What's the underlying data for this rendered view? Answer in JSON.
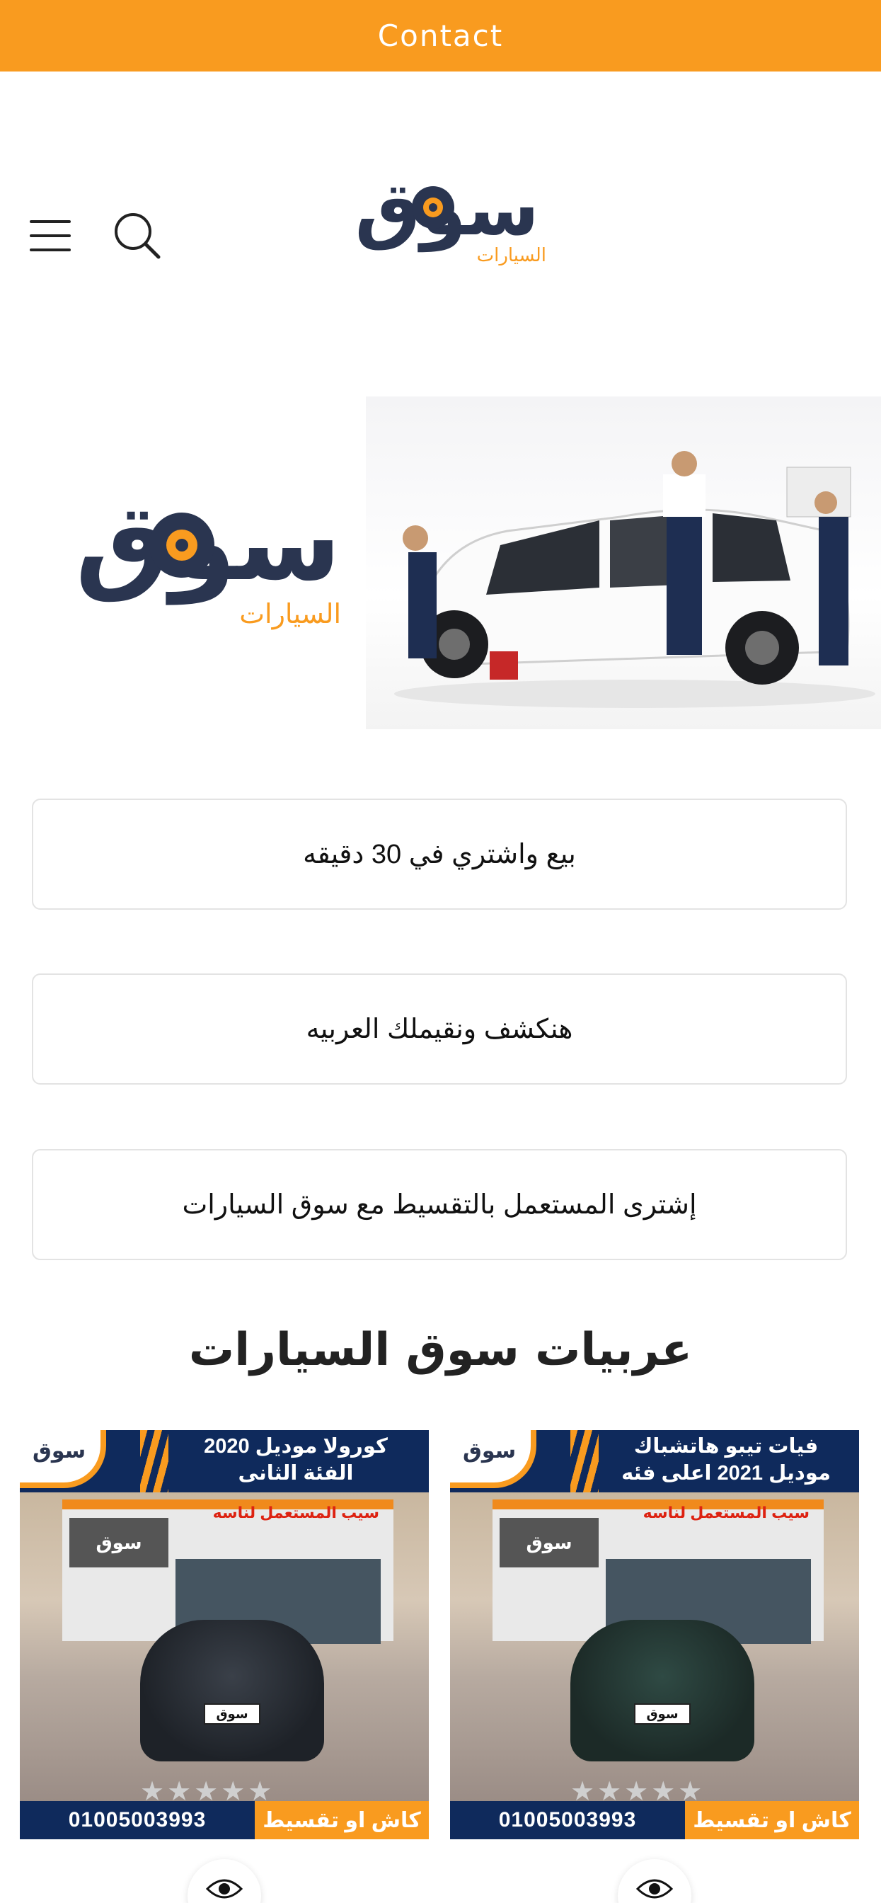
{
  "topbar": {
    "contact_label": "Contact"
  },
  "header": {
    "menu_icon": "hamburger-menu-icon",
    "search_icon": "search-icon",
    "logo_main": "سوق",
    "logo_sub": "السيارات"
  },
  "hero": {
    "logo_main": "سوق",
    "logo_sub": "السيارات"
  },
  "features": [
    {
      "text": "بيع واشتري في 30 دقيقه"
    },
    {
      "text": "هنكشف ونقيملك العربيه"
    },
    {
      "text": "إشترى المستعمل بالتقسيط مع سوق السيارات"
    }
  ],
  "section": {
    "title": "عربيات سوق السيارات"
  },
  "cards": [
    {
      "title_line1": "كورولا  موديل 2020",
      "title_line2": "الفئة الثانى",
      "logo": "سوق",
      "sign": "سوق",
      "sign_red": "سيب المستعمل لناسه",
      "plate": "سوق",
      "stars": "★★★★★",
      "phone": "01005003993",
      "cash_label": "كاش او تقسيط"
    },
    {
      "title_line1": "فيات تيبو هاتشباك",
      "title_line2": "موديل 2021  اعلى فئه",
      "logo": "سوق",
      "sign": "سوق",
      "sign_red": "سيب المستعمل لناسه",
      "plate": "سوق",
      "stars": "★★★★★",
      "phone": "01005003993",
      "cash_label": "كاش او تقسيط"
    }
  ],
  "colors": {
    "accent": "#f99b1f",
    "navy": "#0f2a5c",
    "logo_dark": "#2a3550"
  }
}
